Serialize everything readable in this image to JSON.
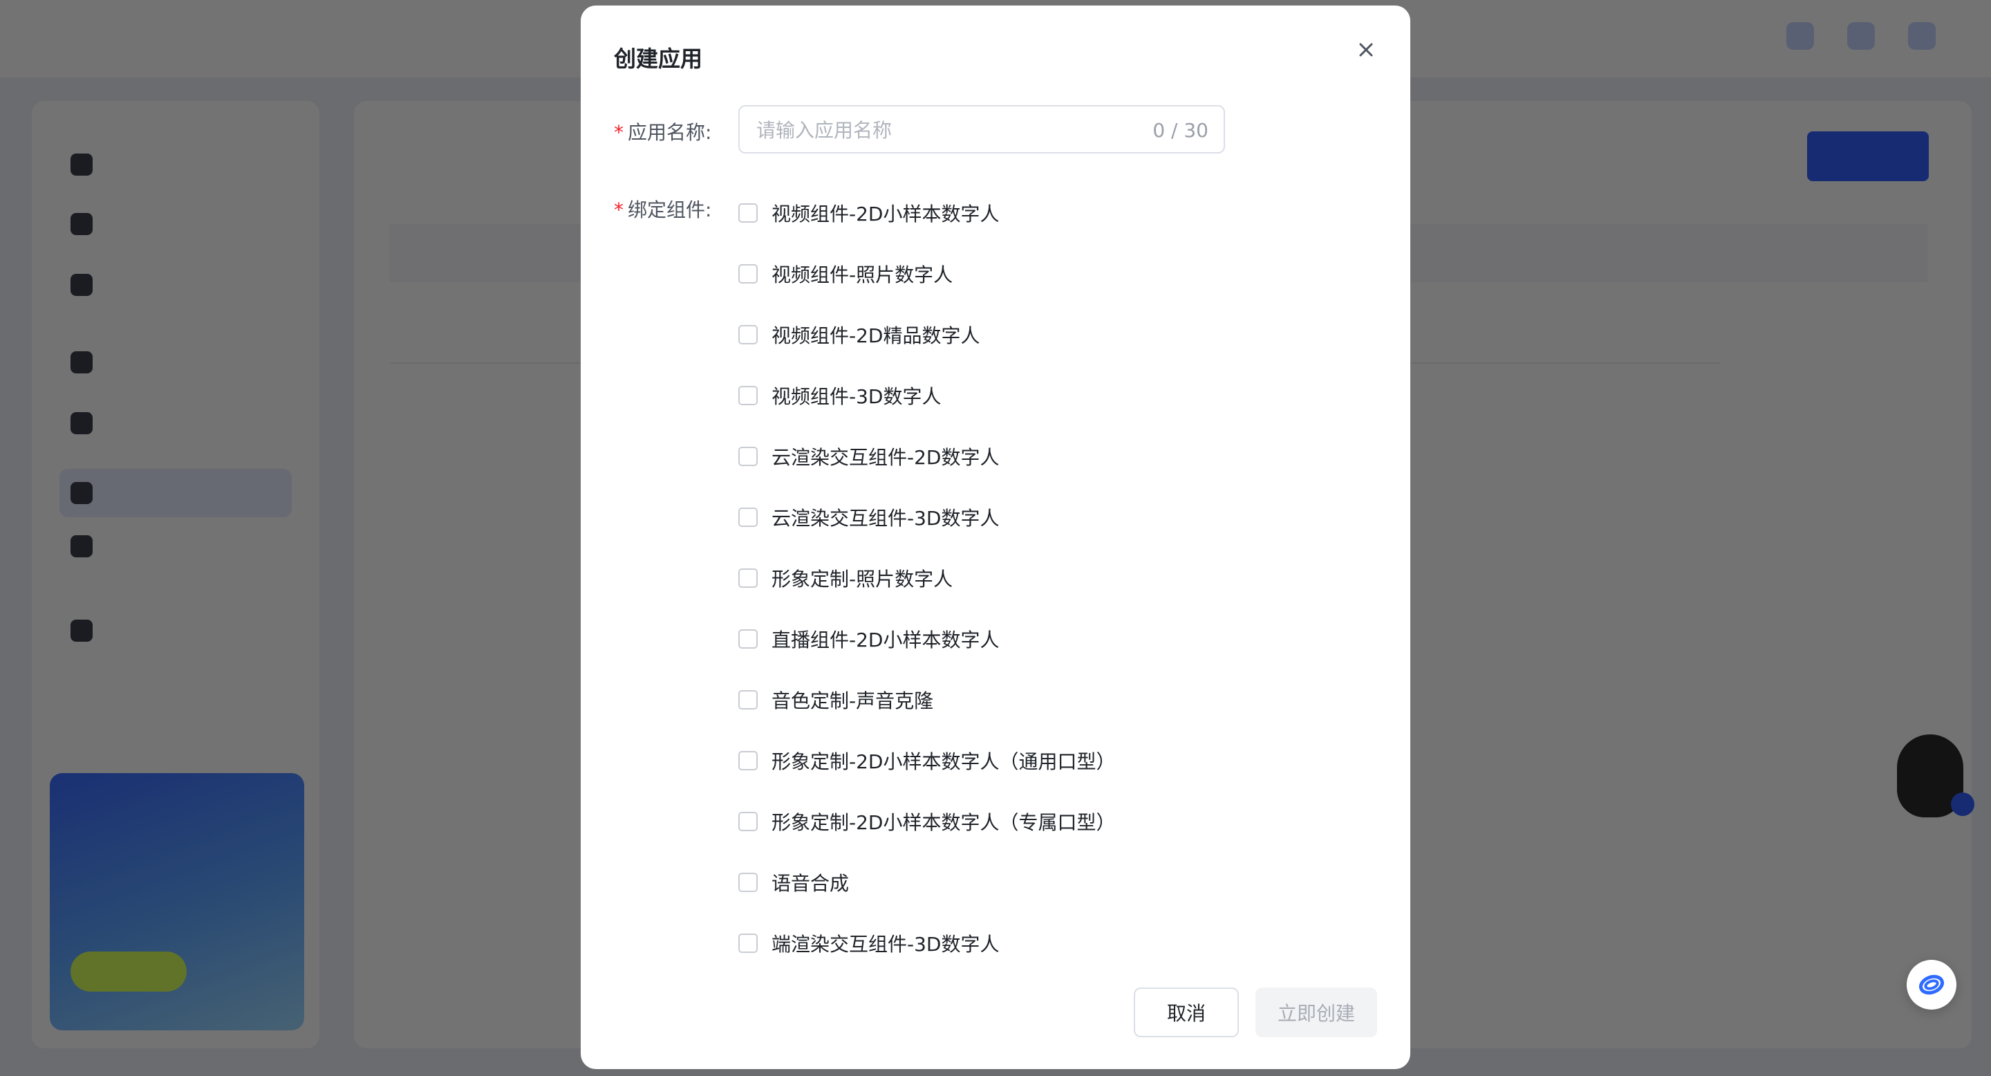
{
  "modal": {
    "title": "创建应用",
    "name_label": "应用名称:",
    "name_placeholder": "请输入应用名称",
    "name_value": "",
    "name_counter": "0 / 30",
    "components_label": "绑定组件:",
    "components": [
      {
        "label": "视频组件-2D小样本数字人",
        "checked": false
      },
      {
        "label": "视频组件-照片数字人",
        "checked": false
      },
      {
        "label": "视频组件-2D精品数字人",
        "checked": false
      },
      {
        "label": "视频组件-3D数字人",
        "checked": false
      },
      {
        "label": "云渲染交互组件-2D数字人",
        "checked": false
      },
      {
        "label": "云渲染交互组件-3D数字人",
        "checked": false
      },
      {
        "label": "形象定制-照片数字人",
        "checked": false
      },
      {
        "label": "直播组件-2D小样本数字人",
        "checked": false
      },
      {
        "label": "音色定制-声音克隆",
        "checked": false
      },
      {
        "label": "形象定制-2D小样本数字人（通用口型）",
        "checked": false
      },
      {
        "label": "形象定制-2D小样本数字人（专属口型）",
        "checked": false
      },
      {
        "label": "语音合成",
        "checked": false
      },
      {
        "label": "端渲染交互组件-3D数字人",
        "checked": false
      }
    ],
    "cancel_label": "取消",
    "create_label": "立即创建"
  },
  "colors": {
    "accent": "#3361ff",
    "required": "#f5222d",
    "overlay": "rgba(0,0,0,0.55)"
  },
  "icons": {
    "close": "close-icon",
    "float_assistant": "assistant-icon"
  }
}
